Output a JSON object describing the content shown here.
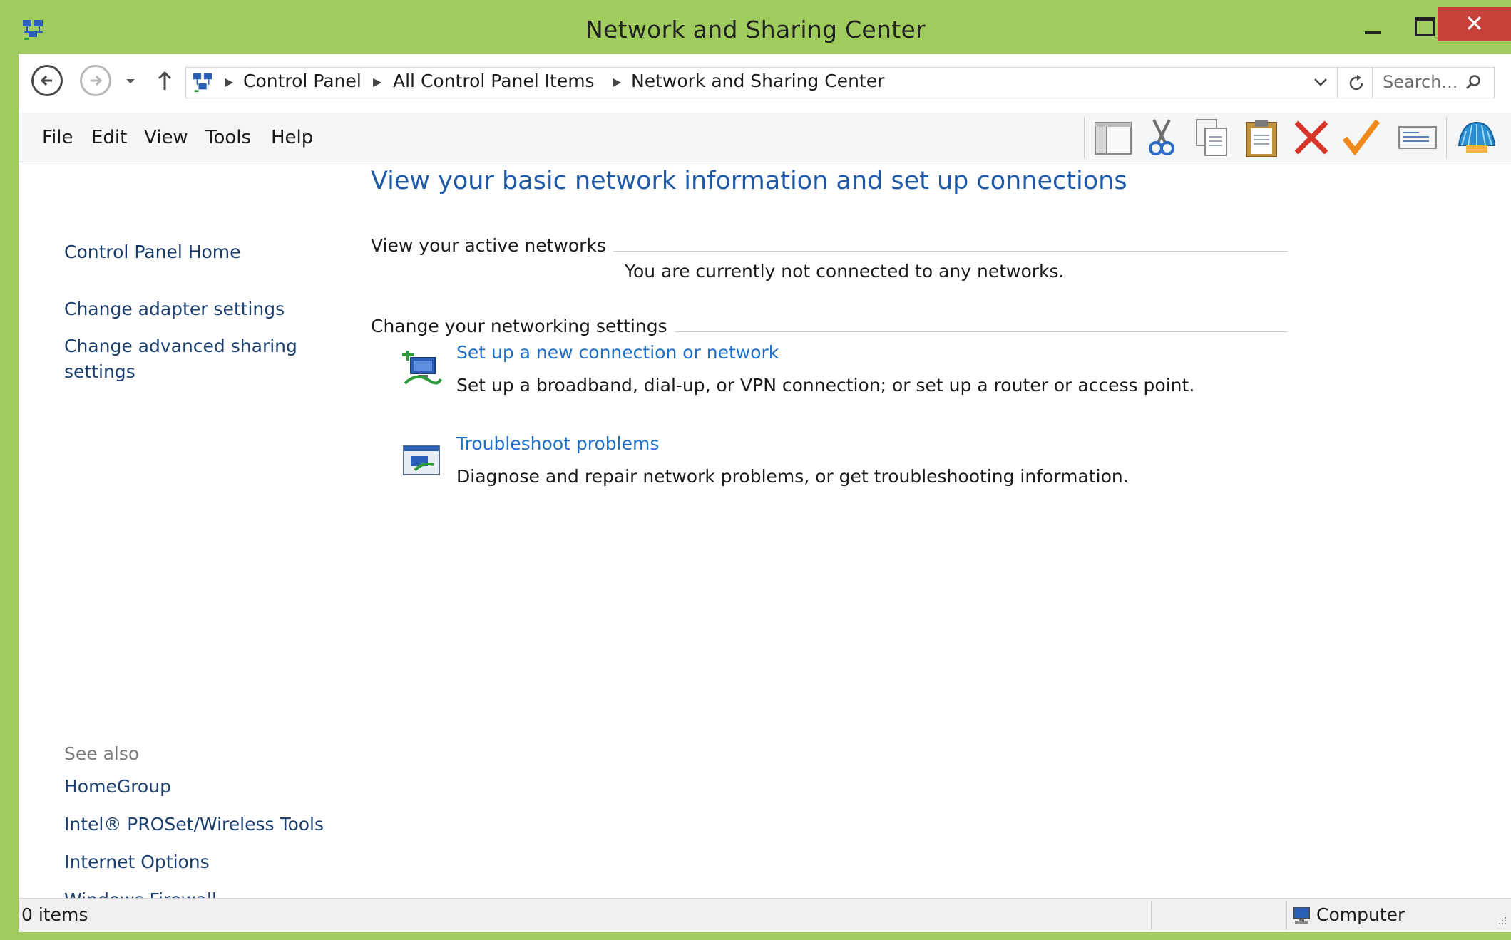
{
  "window": {
    "title": "Network and Sharing Center",
    "accent_color": "#9fcc5c",
    "close_color": "#c7403a",
    "close_glyph": "✕"
  },
  "address_bar": {
    "breadcrumbs": [
      "Control Panel",
      "All Control Panel Items",
      "Network and Sharing Center"
    ],
    "search_placeholder": "Search..."
  },
  "menu": {
    "items": [
      "File",
      "Edit",
      "View",
      "Tools",
      "Help"
    ]
  },
  "toolbar": {
    "icons": [
      "layout-pane-icon",
      "cut-icon",
      "copy-icon",
      "paste-icon",
      "delete-icon",
      "checkmark-icon",
      "properties-icon",
      "shell-icon"
    ]
  },
  "left_pane": {
    "home": "Control Panel Home",
    "links": [
      "Change adapter settings",
      "Change advanced sharing settings"
    ],
    "see_also_label": "See also",
    "see_also": [
      "HomeGroup",
      "Intel® PROSet/Wireless Tools",
      "Internet Options",
      "Windows Firewall"
    ]
  },
  "main": {
    "title": "View your basic network information and set up connections",
    "active_networks_heading": "View your active networks",
    "active_networks_status": "You are currently not connected to any networks.",
    "settings_heading": "Change your networking settings",
    "tasks": [
      {
        "link": "Set up a new connection or network",
        "description": "Set up a broadband, dial-up, or VPN connection; or set up a router or access point.",
        "icon": "new-connection-icon"
      },
      {
        "link": "Troubleshoot problems",
        "description": "Diagnose and repair network problems, or get troubleshooting information.",
        "icon": "troubleshoot-icon"
      }
    ]
  },
  "status_bar": {
    "items_count": "0 items",
    "location": "Computer"
  }
}
